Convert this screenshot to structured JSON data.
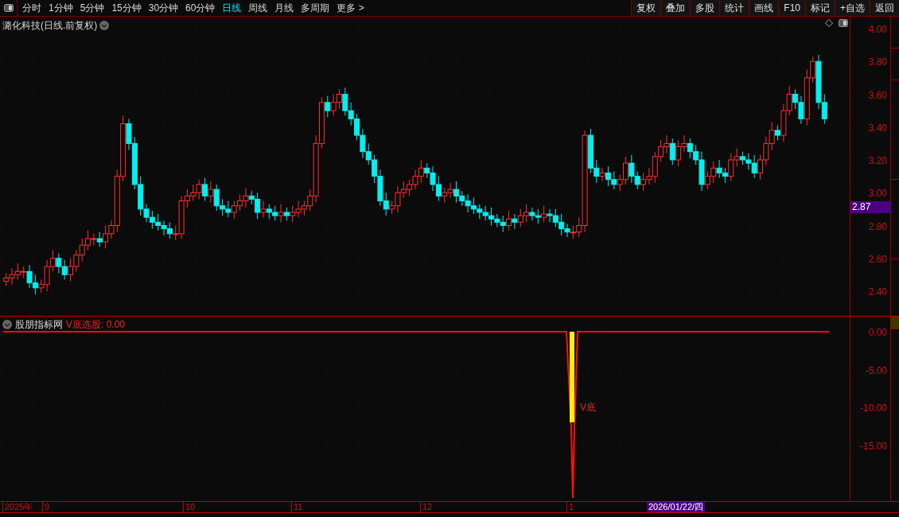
{
  "toolbar": {
    "periods": [
      {
        "label": "分时",
        "selected": false
      },
      {
        "label": "1分钟",
        "selected": false
      },
      {
        "label": "5分钟",
        "selected": false
      },
      {
        "label": "15分钟",
        "selected": false
      },
      {
        "label": "30分钟",
        "selected": false
      },
      {
        "label": "60分钟",
        "selected": false
      },
      {
        "label": "日线",
        "selected": true
      },
      {
        "label": "周线",
        "selected": false
      },
      {
        "label": "月线",
        "selected": false
      },
      {
        "label": "多周期",
        "selected": false
      },
      {
        "label": "更多 >",
        "selected": false
      }
    ],
    "actions": [
      "复权",
      "叠加",
      "多股",
      "统计",
      "画线",
      "F10",
      "标记",
      "+自选",
      "返回"
    ]
  },
  "main_chart": {
    "title": "潞化科技(日线.前复权)",
    "price_ticks": [
      "4.00",
      "3.80",
      "3.60",
      "3.40",
      "3.20",
      "3.00",
      "2.80",
      "2.60",
      "2.40"
    ],
    "current_price": "2.87"
  },
  "indicator": {
    "name": "股朋指标网",
    "value_label": "V底选股: 0.00",
    "signal_label": "V底",
    "ticks": [
      "0.00",
      "-5.00",
      "-10.00",
      "-15.00"
    ]
  },
  "date_axis": {
    "labels": [
      "2025年",
      "9",
      "10",
      "11",
      "12",
      "1"
    ],
    "cursor_date": "2026/01/22/四"
  }
}
